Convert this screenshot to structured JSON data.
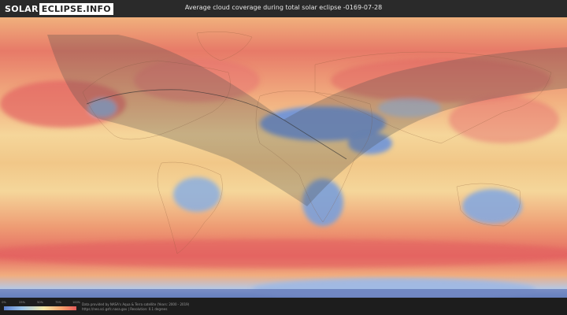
{
  "header": {
    "logo_part1": "SOLAR",
    "logo_part2": "ECLIPSE.INFO",
    "title": "Average cloud coverage during total solar eclipse -0169-07-28"
  },
  "map": {
    "type": "cloud coverage world map",
    "eclipse_path": "total solar eclipse path arcing from North America across the Atlantic to Africa",
    "colors": {
      "clear": "#5b7fd0",
      "low": "#9cc4e8",
      "mid": "#f4e8a6",
      "high": "#f4a06c",
      "overcast": "#e55a5a",
      "shadow": "#555555"
    }
  },
  "legend": {
    "ticks": [
      "0%",
      "25%",
      "50%",
      "75%",
      "100%"
    ]
  },
  "footer": {
    "credit_line1": "Data provided by NASA's Aqua & Terra satellite (Years: 2000 - 2019)",
    "credit_line2": "https://neo.sci.gsfc.nasa.gov | Resolution: 0.1 degrees"
  }
}
